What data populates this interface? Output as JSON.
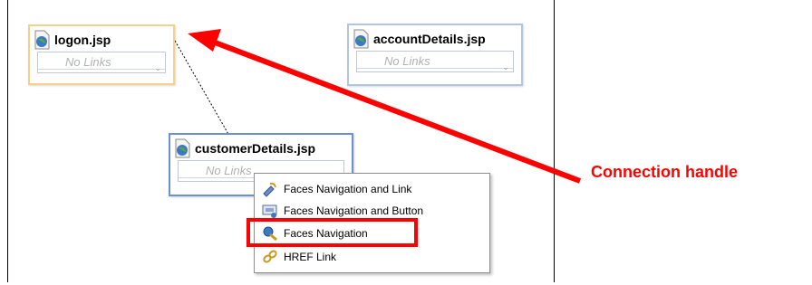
{
  "canvas": {
    "nodes": [
      {
        "title": "logon.jsp",
        "links_placeholder": "No Links"
      },
      {
        "title": "accountDetails.jsp",
        "links_placeholder": "No Links"
      },
      {
        "title": "customerDetails.jsp",
        "links_placeholder": "No Links"
      }
    ]
  },
  "context_menu": {
    "items": [
      {
        "label": "Faces Navigation and Link",
        "icon": "faces-link-icon"
      },
      {
        "label": "Faces Navigation and Button",
        "icon": "faces-button-icon"
      },
      {
        "label": "Faces Navigation",
        "icon": "faces-navigation-icon"
      },
      {
        "label": "HREF Link",
        "icon": "href-link-icon"
      }
    ],
    "highlighted_item": "Faces Navigation"
  },
  "annotation": {
    "callout_text": "Connection handle",
    "color": "#ff0000"
  }
}
